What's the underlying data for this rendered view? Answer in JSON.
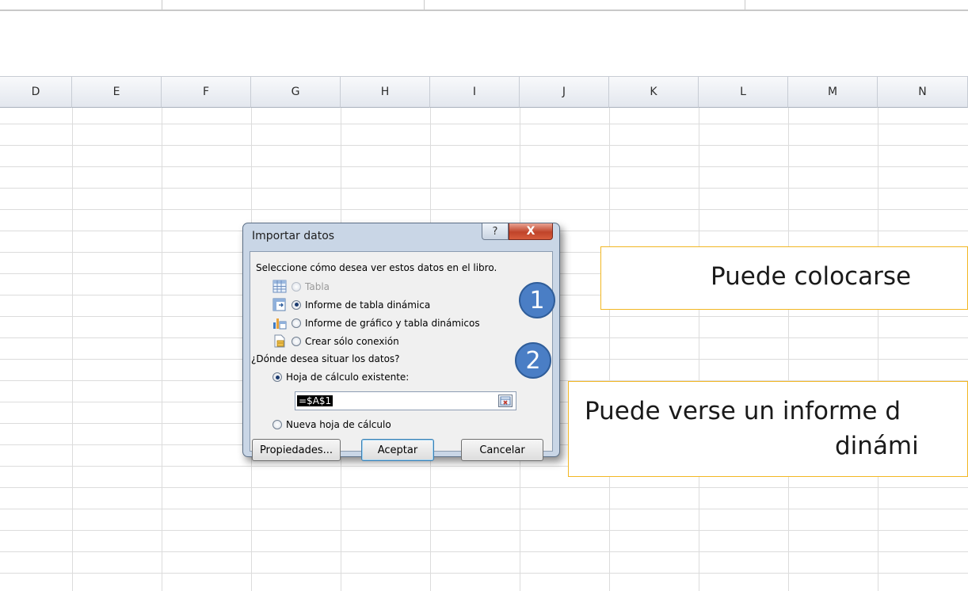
{
  "sheet": {
    "columns": [
      "D",
      "E",
      "F",
      "G",
      "H",
      "I",
      "J",
      "K",
      "L",
      "M",
      "N"
    ]
  },
  "dialog": {
    "title": "Importar datos",
    "help_icon": "?",
    "close_icon": "X",
    "prompt": "Seleccione cómo desea ver estos datos en el libro.",
    "view_options": [
      {
        "label": "Tabla",
        "icon": "table-icon",
        "checked": false,
        "disabled": true
      },
      {
        "label": "Informe de tabla dinámica",
        "icon": "pivot-table-icon",
        "checked": true,
        "disabled": false
      },
      {
        "label": "Informe de gráfico y tabla dinámicos",
        "icon": "pivot-chart-icon",
        "checked": false,
        "disabled": false
      },
      {
        "label": "Crear sólo conexión",
        "icon": "connection-icon",
        "checked": false,
        "disabled": false
      }
    ],
    "location_prompt": "¿Dónde desea situar los datos?",
    "location_options": [
      {
        "label": "Hoja de cálculo existente:",
        "checked": true
      },
      {
        "label": "Nueva hoja de cálculo",
        "checked": false
      }
    ],
    "reference_value": "=$A$1",
    "buttons": {
      "properties": "Propiedades...",
      "ok": "Aceptar",
      "cancel": "Cancelar"
    }
  },
  "annotations": {
    "markers": [
      "1",
      "2"
    ],
    "callout_1": "Puede colocarse",
    "callout_2_line1": "Puede verse un informe d",
    "callout_2_line2": "dinámi"
  },
  "colors": {
    "marker_fill": "#4a7ec5",
    "callout_border": "#f2b723",
    "close_button": "#c0442a"
  }
}
